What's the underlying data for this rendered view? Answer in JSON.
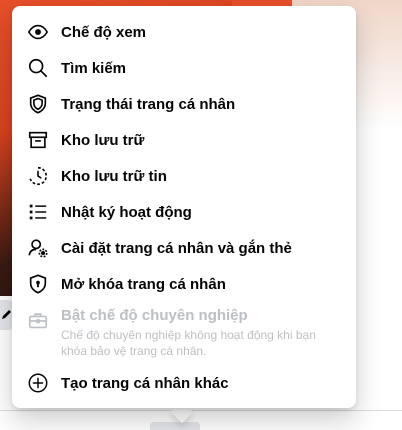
{
  "menu": {
    "items": [
      {
        "icon": "eye-icon",
        "label": "Chế độ xem"
      },
      {
        "icon": "search-icon",
        "label": "Tìm kiếm"
      },
      {
        "icon": "shield-icon",
        "label": "Trạng thái trang cá nhân"
      },
      {
        "icon": "archive-box-icon",
        "label": "Kho lưu trữ"
      },
      {
        "icon": "clock-history-icon",
        "label": "Kho lưu trữ tin"
      },
      {
        "icon": "list-icon",
        "label": "Nhật ký hoạt động"
      },
      {
        "icon": "profile-settings-icon",
        "label": "Cài đặt trang cá nhân và gắn thẻ"
      },
      {
        "icon": "shield-lock-icon",
        "label": "Mở khóa trang cá nhân"
      }
    ],
    "professional_mode": {
      "icon": "briefcase-icon",
      "label": "Bật chế độ chuyên nghiệp",
      "description": "Chế độ chuyên nghiệp không hoạt động khi bạn khóa bảo vệ trang cá nhân."
    },
    "create_profile": {
      "icon": "plus-circle-icon",
      "label": "Tạo trang cá nhân khác"
    }
  },
  "colors": {
    "text": "#050505",
    "disabled_text": "#bcc0c4",
    "brand_orange": "#e7502b"
  }
}
